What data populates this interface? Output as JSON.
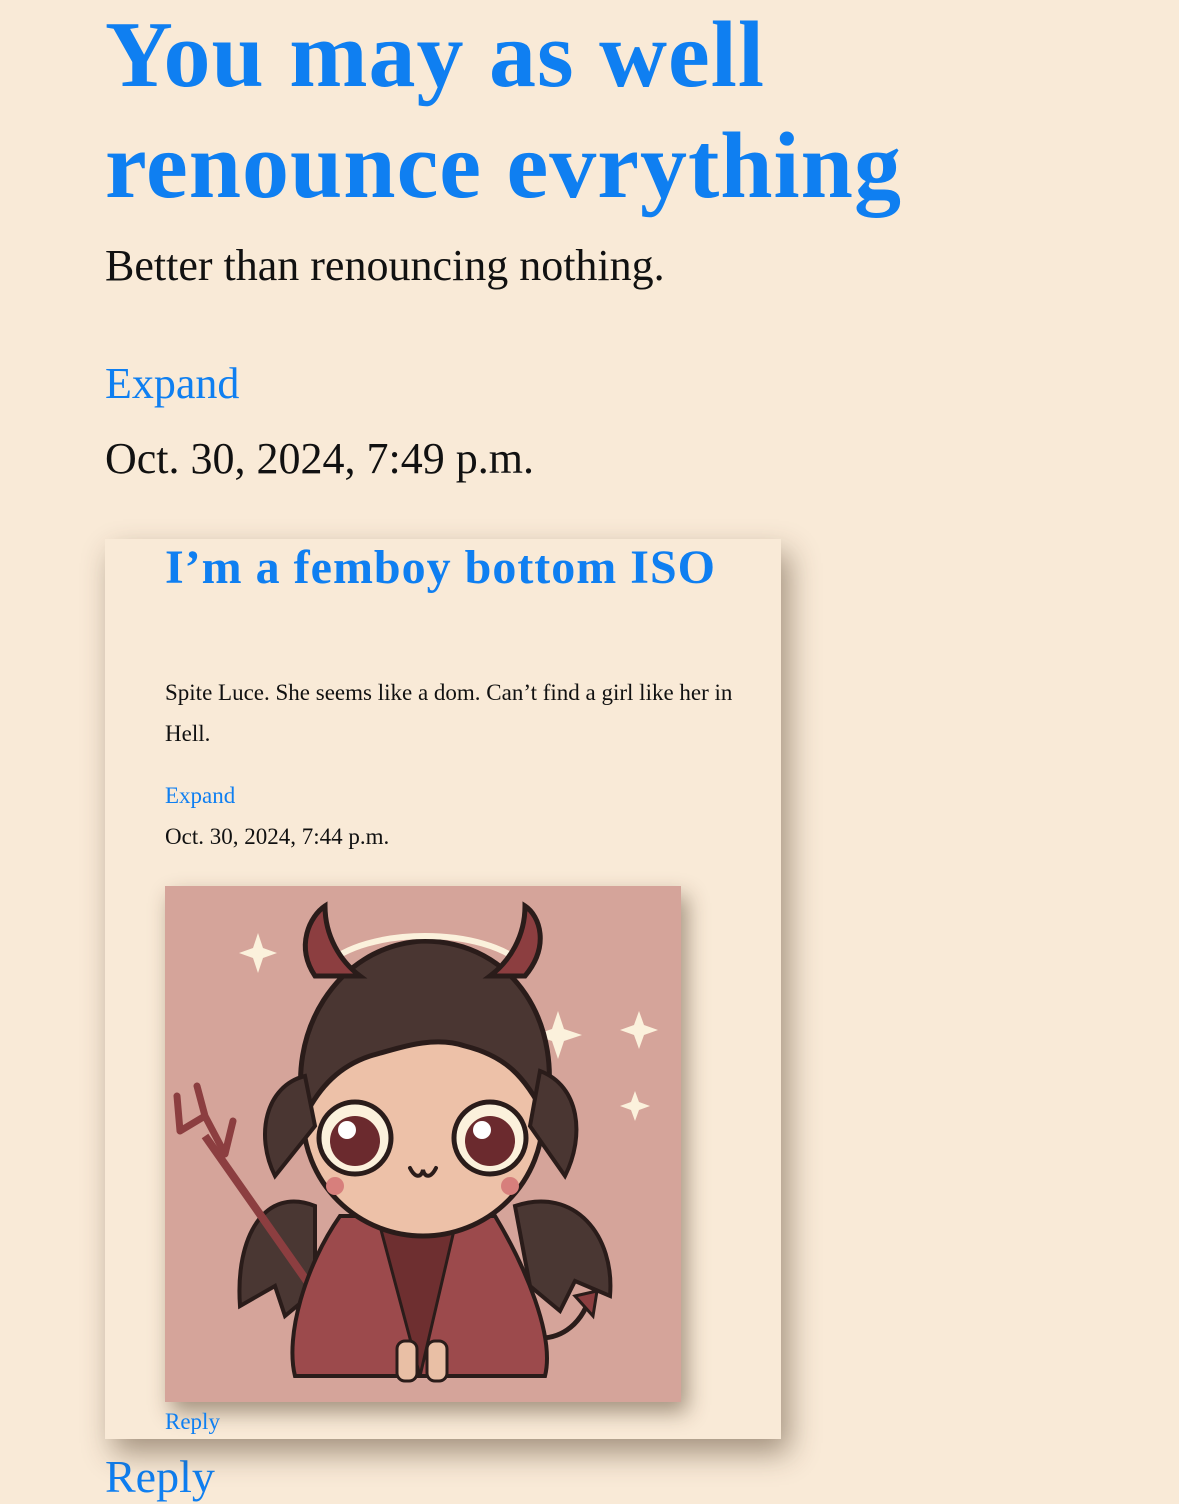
{
  "post": {
    "title": "You may as well renounce evrything",
    "subtitle": "Better than renouncing nothing.",
    "expand_label": "Expand",
    "date": "Oct. 30, 2024, 7:49 p.m.",
    "reply_label": "Reply"
  },
  "quoted_post": {
    "title": "I’m a femboy bottom ISO",
    "body": "Spite Luce. She seems like a dom. Can’t find a girl like her in Hell.",
    "expand_label": "Expand",
    "date": "Oct. 30, 2024, 7:44 p.m.",
    "image_icon": "chibi-devil-illustration",
    "reply_label": "Reply"
  },
  "colors": {
    "background": "#f9ead7",
    "link": "#0f7ff1",
    "text": "#111111",
    "image_background": "#d5a49a"
  }
}
